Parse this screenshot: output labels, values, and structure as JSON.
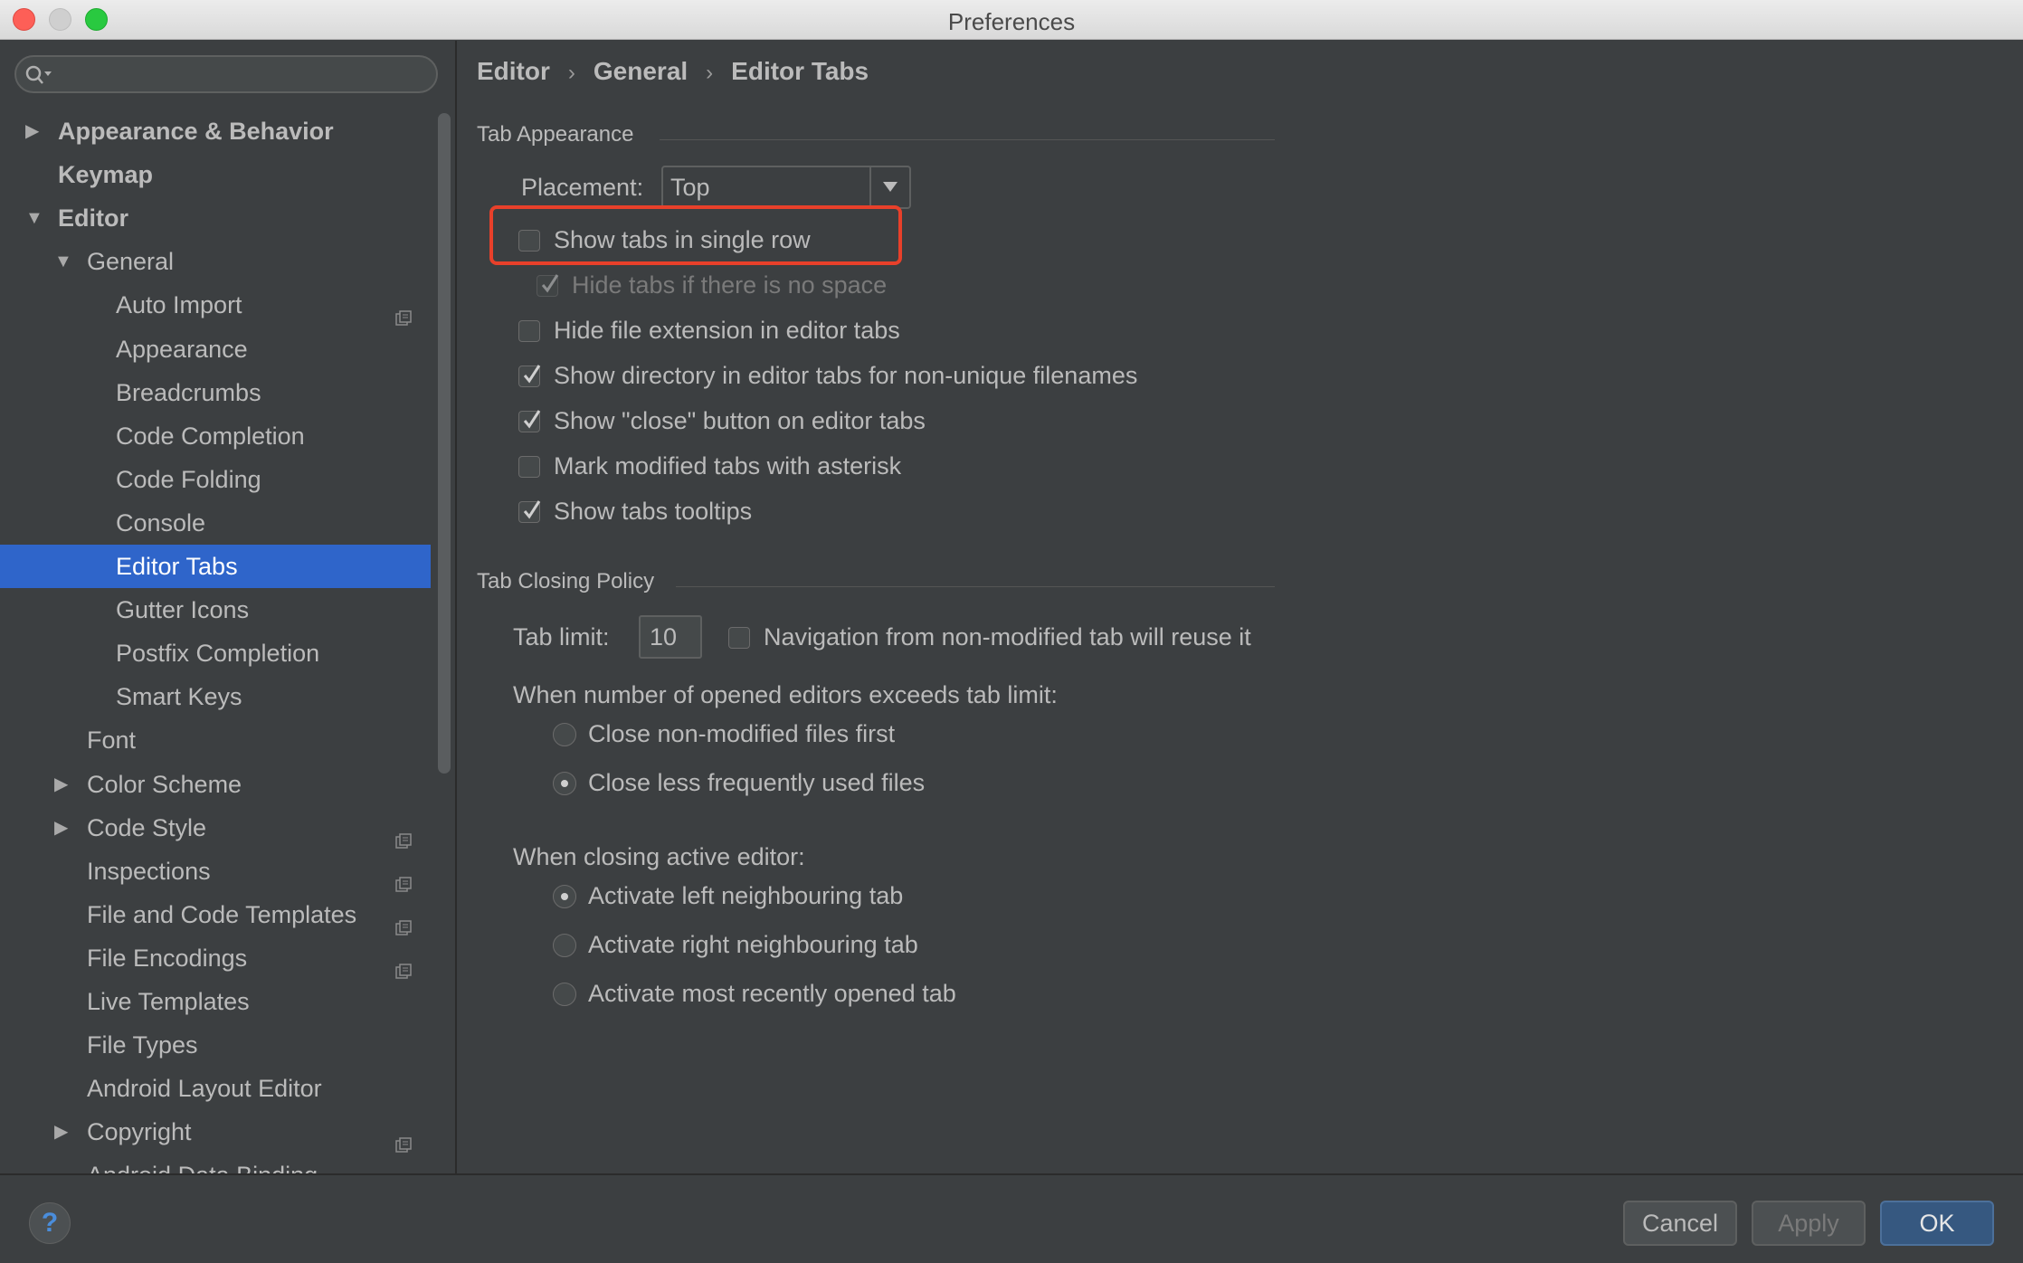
{
  "window": {
    "title": "Preferences"
  },
  "search": {
    "placeholder": ""
  },
  "sidebar": {
    "items": [
      {
        "label": "Appearance & Behavior",
        "arrow": "▶",
        "bold": true
      },
      {
        "label": "Keymap",
        "arrow": "",
        "bold": true
      },
      {
        "label": "Editor",
        "arrow": "▼",
        "bold": true
      },
      {
        "label": "General",
        "arrow": "▼"
      },
      {
        "label": "Auto Import",
        "project_icon": true
      },
      {
        "label": "Appearance"
      },
      {
        "label": "Breadcrumbs"
      },
      {
        "label": "Code Completion"
      },
      {
        "label": "Code Folding"
      },
      {
        "label": "Console"
      },
      {
        "label": "Editor Tabs",
        "selected": true
      },
      {
        "label": "Gutter Icons"
      },
      {
        "label": "Postfix Completion"
      },
      {
        "label": "Smart Keys"
      },
      {
        "label": "Font"
      },
      {
        "label": "Color Scheme",
        "arrow": "▶"
      },
      {
        "label": "Code Style",
        "arrow": "▶",
        "project_icon": true
      },
      {
        "label": "Inspections",
        "project_icon": true
      },
      {
        "label": "File and Code Templates",
        "project_icon": true
      },
      {
        "label": "File Encodings",
        "project_icon": true
      },
      {
        "label": "Live Templates"
      },
      {
        "label": "File Types"
      },
      {
        "label": "Android Layout Editor"
      },
      {
        "label": "Copyright",
        "arrow": "▶",
        "project_icon": true
      },
      {
        "label": "Android Data Binding"
      }
    ]
  },
  "breadcrumb": {
    "items": [
      "Editor",
      "General",
      "Editor Tabs"
    ],
    "separator": "›"
  },
  "tab_appearance": {
    "title": "Tab Appearance",
    "placement_label": "Placement:",
    "placement_value": "Top",
    "options": [
      {
        "label": "Show tabs in single row",
        "checked": false,
        "enabled": true
      },
      {
        "label": "Hide tabs if there is no space",
        "checked": true,
        "enabled": false
      },
      {
        "label": "Hide file extension in editor tabs",
        "checked": false,
        "enabled": true
      },
      {
        "label": "Show directory in editor tabs for non-unique filenames",
        "checked": true,
        "enabled": true
      },
      {
        "label": "Show \"close\" button on editor tabs",
        "checked": true,
        "enabled": true
      },
      {
        "label": "Mark modified tabs with asterisk",
        "checked": false,
        "enabled": true
      },
      {
        "label": "Show tabs tooltips",
        "checked": true,
        "enabled": true
      }
    ]
  },
  "tab_closing": {
    "title": "Tab Closing Policy",
    "tab_limit_label": "Tab limit:",
    "tab_limit_value": "10",
    "reuse_label": "Navigation from non-modified tab will reuse it",
    "reuse_checked": false,
    "exceeds_label": "When number of opened editors exceeds tab limit:",
    "exceeds_options": [
      {
        "label": "Close non-modified files first",
        "selected": false
      },
      {
        "label": "Close less frequently used files",
        "selected": true
      }
    ],
    "closing_label": "When closing active editor:",
    "closing_options": [
      {
        "label": "Activate left neighbouring tab",
        "selected": true
      },
      {
        "label": "Activate right neighbouring tab",
        "selected": false
      },
      {
        "label": "Activate most recently opened tab",
        "selected": false
      }
    ]
  },
  "buttons": {
    "help": "?",
    "cancel": "Cancel",
    "apply": "Apply",
    "ok": "OK"
  },
  "colors": {
    "accent": "#2f65ca",
    "highlight": "#e8402a",
    "background": "#3c3f41"
  }
}
